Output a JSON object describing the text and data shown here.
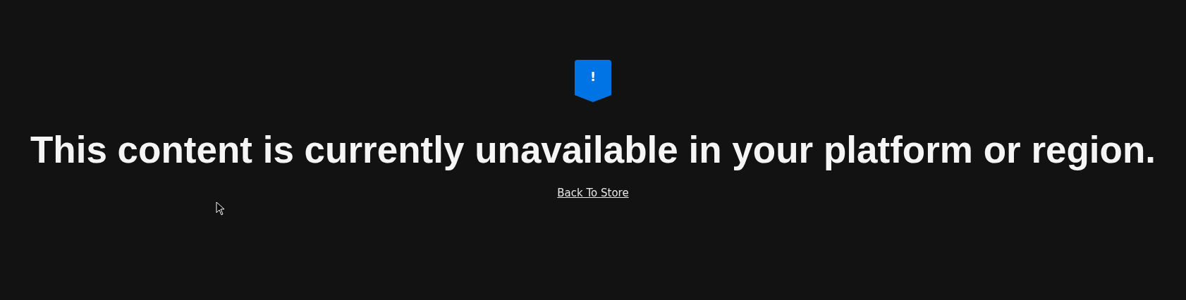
{
  "notice": {
    "icon": "!",
    "heading": "This content is currently unavailable in your platform or region.",
    "link": "Back To Store"
  }
}
